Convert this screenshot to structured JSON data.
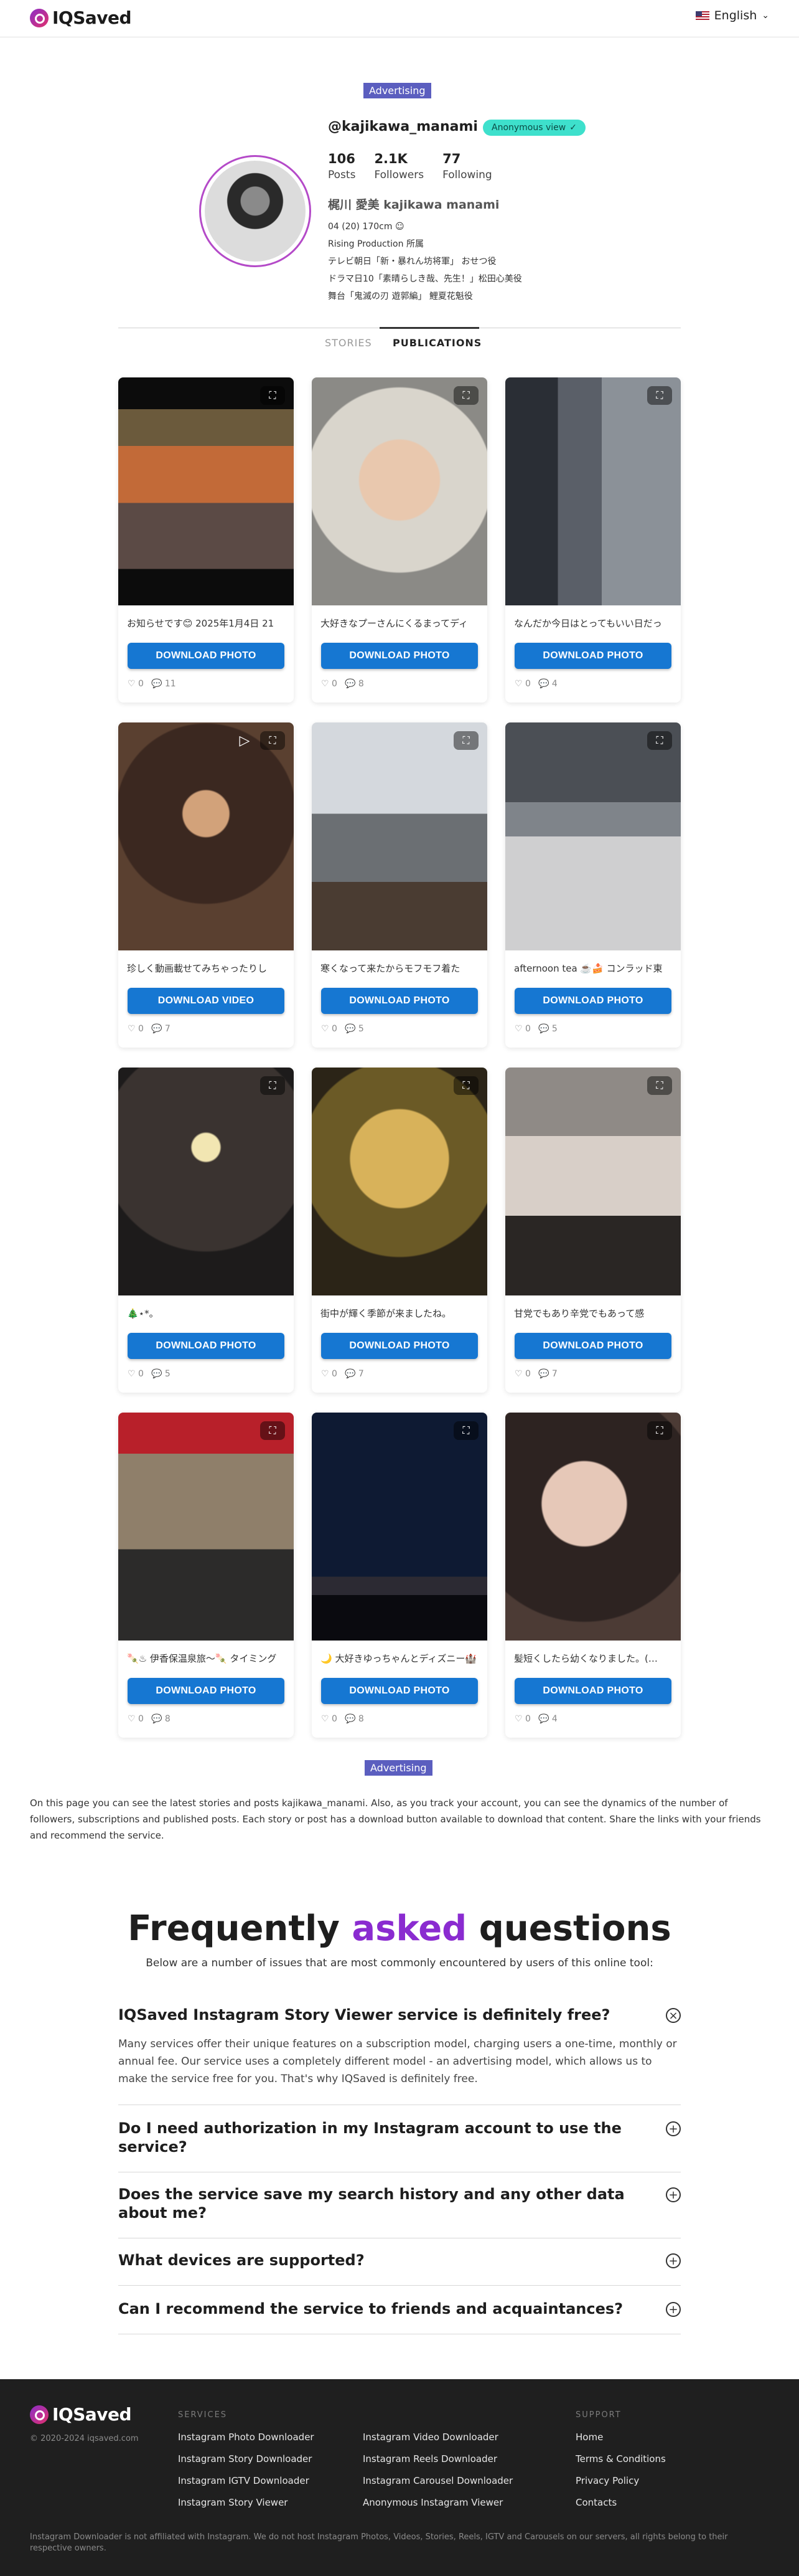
{
  "header": {
    "logo": "IQSaved",
    "language": "English"
  },
  "ads": {
    "top": "Advertising",
    "bottom": "Advertising"
  },
  "profile": {
    "username": "@kajikawa_manami",
    "anonymous_badge": "Anonymous view",
    "stats": [
      {
        "value": "106",
        "label": "Posts"
      },
      {
        "value": "2.1K",
        "label": "Followers"
      },
      {
        "value": "77",
        "label": "Following"
      }
    ],
    "full_name": "梶川 愛美 kajikawa manami",
    "bio_lines": [
      "04 (20) 170cm ☺",
      "Rising Production 所属",
      "テレビ朝日「新・暴れん坊将軍」 おせつ役",
      "ドラマ日10「素晴らしき哉、先生！」松田心美役",
      "舞台「鬼滅の刃 遊郭編」 鯉夏花魁役"
    ]
  },
  "tabs": {
    "stories": "STORIES",
    "publications": "PUBLICATIONS"
  },
  "posts": [
    {
      "caption": "お知らせです😊 2025年1月4日 21",
      "button": "DOWNLOAD PHOTO",
      "likes": "0",
      "comments": "11",
      "video": false
    },
    {
      "caption": "大好きなプーさんにくるまってディ",
      "button": "DOWNLOAD PHOTO",
      "likes": "0",
      "comments": "8",
      "video": false
    },
    {
      "caption": "なんだか今日はとってもいい日だっ",
      "button": "DOWNLOAD PHOTO",
      "likes": "0",
      "comments": "4",
      "video": false
    },
    {
      "caption": "珍しく動画載せてみちゃったりし",
      "button": "DOWNLOAD VIDEO",
      "likes": "0",
      "comments": "7",
      "video": true
    },
    {
      "caption": "寒くなって来たからモフモフ着た",
      "button": "DOWNLOAD PHOTO",
      "likes": "0",
      "comments": "5",
      "video": false
    },
    {
      "caption": "afternoon tea ☕️🍰 コンラッド東",
      "button": "DOWNLOAD PHOTO",
      "likes": "0",
      "comments": "5",
      "video": false
    },
    {
      "caption": "🎄⋆*。",
      "button": "DOWNLOAD PHOTO",
      "likes": "0",
      "comments": "5",
      "video": false
    },
    {
      "caption": "街中が輝く季節が来ましたね。",
      "button": "DOWNLOAD PHOTO",
      "likes": "0",
      "comments": "7",
      "video": false
    },
    {
      "caption": "甘党でもあり辛党でもあって感",
      "button": "DOWNLOAD PHOTO",
      "likes": "0",
      "comments": "7",
      "video": false
    },
    {
      "caption": "🍡♨︎ 伊香保温泉旅〜🍡 タイミング",
      "button": "DOWNLOAD PHOTO",
      "likes": "0",
      "comments": "8",
      "video": false
    },
    {
      "caption": "🌙 大好きゆっちゃんとディズニー🏰",
      "button": "DOWNLOAD PHOTO",
      "likes": "0",
      "comments": "8",
      "video": false
    },
    {
      "caption": "髪短くしたら幼くなりました。(…",
      "button": "DOWNLOAD PHOTO",
      "likes": "0",
      "comments": "4",
      "video": false
    }
  ],
  "description": "On this page you can see the latest stories and posts kajikawa_manami. Also, as you track your account, you can see the dynamics of the number of followers, subscriptions and published posts. Each story or post has a download button available to download that content. Share the links with your friends and recommend the service.",
  "faq": {
    "title_part1": "Frequently",
    "title_accent": "asked",
    "title_part2": "questions",
    "subtitle": "Below are a number of issues that are most commonly encountered by users of this online tool:",
    "items": [
      {
        "q": "IQSaved Instagram Story Viewer service is definitely free?",
        "a": "Many services offer their unique features on a subscription model, charging users a one-time, monthly or annual fee. Our service uses a completely different model - an advertising model, which allows us to make the service free for you. That's why IQSaved is definitely free.",
        "open": true
      },
      {
        "q": "Do I need authorization in my Instagram account to use the service?",
        "a": "",
        "open": false
      },
      {
        "q": "Does the service save my search history and any other data about me?",
        "a": "",
        "open": false
      },
      {
        "q": "What devices are supported?",
        "a": "",
        "open": false
      },
      {
        "q": "Can I recommend the service to friends and acquaintances?",
        "a": "",
        "open": false
      }
    ]
  },
  "footer": {
    "logo": "IQSaved",
    "copyright": "© 2020-2024 iqsaved.com",
    "services_title": "SERVICES",
    "services_col1": [
      "Instagram Photo Downloader",
      "Instagram Story Downloader",
      "Instagram IGTV Downloader",
      "Instagram Story Viewer"
    ],
    "services_col2": [
      "Instagram Video Downloader",
      "Instagram Reels Downloader",
      "Instagram Carousel Downloader",
      "Anonymous Instagram Viewer"
    ],
    "support_title": "SUPPORT",
    "support": [
      "Home",
      "Terms & Conditions",
      "Privacy Policy",
      "Contacts"
    ],
    "disclaimer": "Instagram Downloader is not affiliated with Instagram. We do not host Instagram Photos, Videos, Stories, Reels, IGTV and Carousels on our servers, all rights belong to their respective owners."
  }
}
